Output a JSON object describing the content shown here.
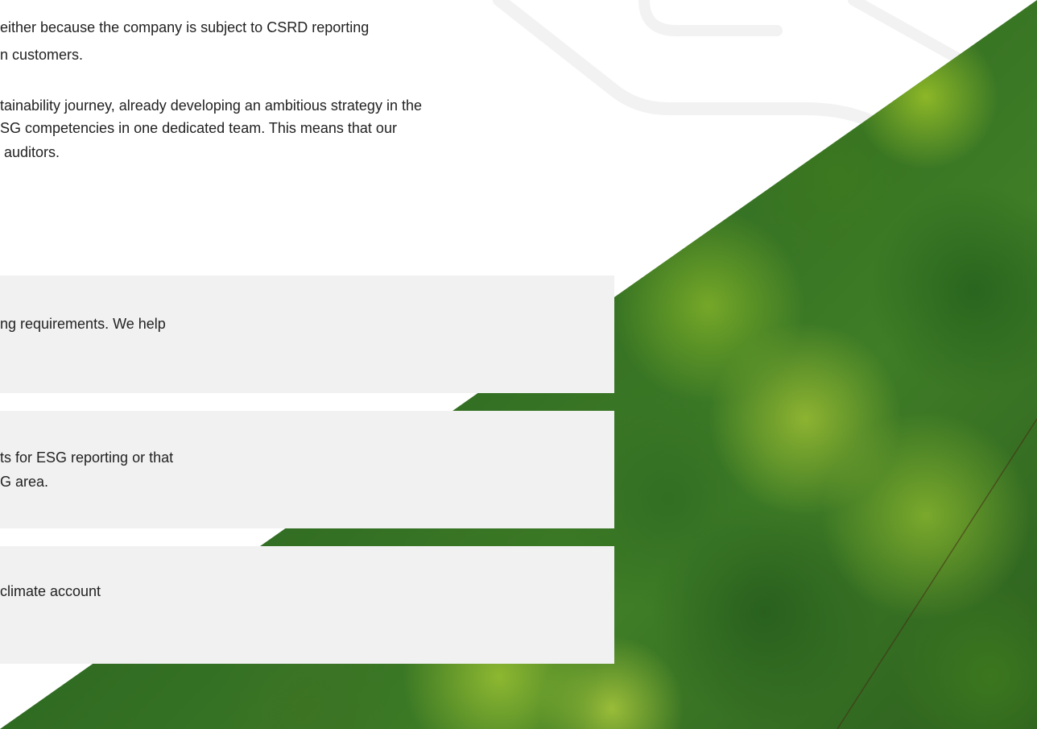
{
  "intro": {
    "line1": "either because the company is subject to CSRD reporting",
    "line2": "n customers.",
    "line3": "tainability journey, already developing an ambitious strategy in the",
    "line4": "SG competencies in one dedicated team. This means that our",
    "line5": " auditors."
  },
  "cards": [
    {
      "line1": "ng requirements. We help",
      "line2": ""
    },
    {
      "line1": "ts for ESG reporting or that",
      "line2": "G area."
    },
    {
      "line1": "climate account",
      "line2": ""
    }
  ],
  "image": {
    "alt_icon": "forest-aerial-image"
  },
  "colors": {
    "card_bg": "#f1f1f1",
    "text": "#222222",
    "forest_dark": "#2f6a22",
    "forest_light": "#96be28"
  }
}
